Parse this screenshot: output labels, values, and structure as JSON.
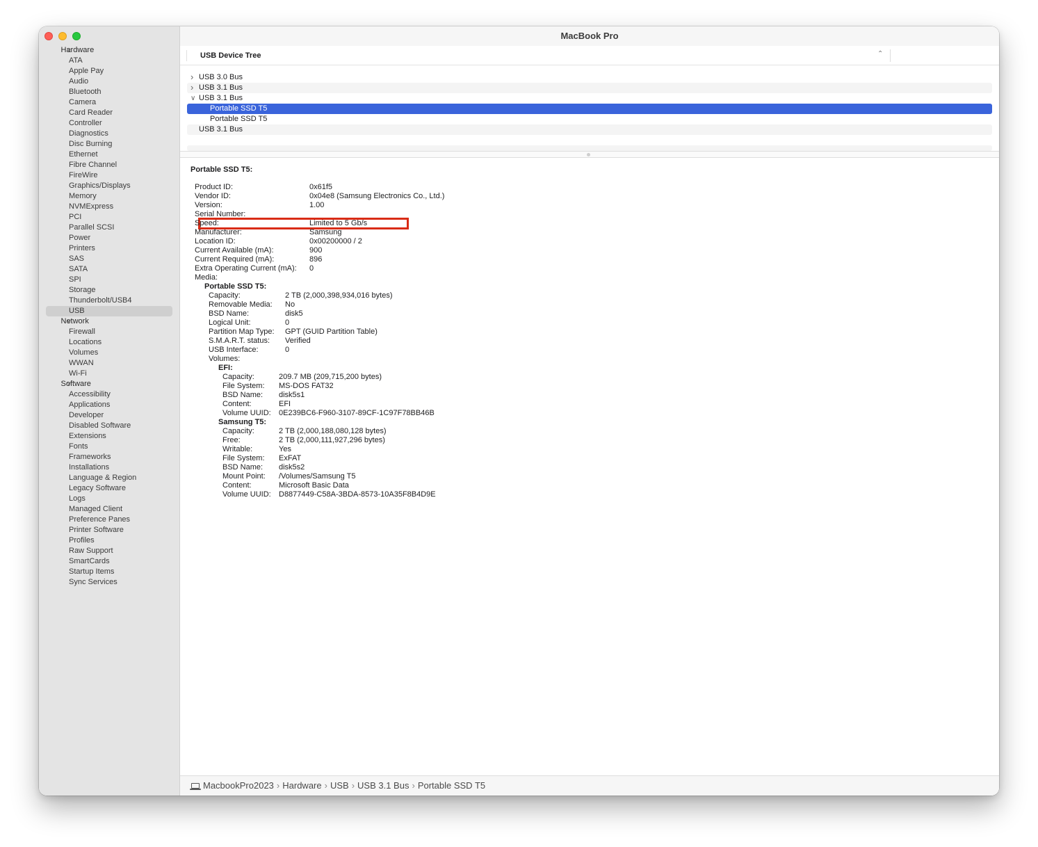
{
  "window": {
    "title": "MacBook Pro"
  },
  "sidebar": {
    "sections": [
      {
        "label": "Hardware",
        "items": [
          "ATA",
          "Apple Pay",
          "Audio",
          "Bluetooth",
          "Camera",
          "Card Reader",
          "Controller",
          "Diagnostics",
          "Disc Burning",
          "Ethernet",
          "Fibre Channel",
          "FireWire",
          "Graphics/Displays",
          "Memory",
          "NVMExpress",
          "PCI",
          "Parallel SCSI",
          "Power",
          "Printers",
          "SAS",
          "SATA",
          "SPI",
          "Storage",
          "Thunderbolt/USB4",
          "USB"
        ]
      },
      {
        "label": "Network",
        "items": [
          "Firewall",
          "Locations",
          "Volumes",
          "WWAN",
          "Wi-Fi"
        ]
      },
      {
        "label": "Software",
        "items": [
          "Accessibility",
          "Applications",
          "Developer",
          "Disabled Software",
          "Extensions",
          "Fonts",
          "Frameworks",
          "Installations",
          "Language & Region",
          "Legacy Software",
          "Logs",
          "Managed Client",
          "Preference Panes",
          "Printer Software",
          "Profiles",
          "Raw Support",
          "SmartCards",
          "Startup Items",
          "Sync Services"
        ]
      }
    ],
    "selected": "USB"
  },
  "device_tree": {
    "header": "USB Device Tree",
    "rows": [
      {
        "label": "USB 3.0 Bus",
        "level": 0,
        "expanded": false
      },
      {
        "label": "USB 3.1 Bus",
        "level": 0,
        "expanded": false
      },
      {
        "label": "USB 3.1 Bus",
        "level": 0,
        "expanded": true
      },
      {
        "label": "Portable SSD T5",
        "level": 1,
        "selected": true
      },
      {
        "label": "Portable SSD T5",
        "level": 1
      },
      {
        "label": "USB 3.1 Bus",
        "level": 0
      }
    ]
  },
  "detail": {
    "title": "Portable SSD T5:",
    "fields": [
      {
        "k": "Product ID:",
        "v": "0x61f5"
      },
      {
        "k": "Vendor ID:",
        "v": "0x04e8  (Samsung Electronics Co., Ltd.)"
      },
      {
        "k": "Version:",
        "v": "1.00"
      },
      {
        "k": "Serial Number:",
        "v": ""
      },
      {
        "k": "Speed:",
        "v": "Limited to 5 Gb/s"
      },
      {
        "k": "Manufacturer:",
        "v": "Samsung"
      },
      {
        "k": "Location ID:",
        "v": "0x00200000 / 2"
      },
      {
        "k": "Current Available (mA):",
        "v": "900"
      },
      {
        "k": "Current Required (mA):",
        "v": "896"
      },
      {
        "k": "Extra Operating Current (mA):",
        "v": "0"
      },
      {
        "k": "Media:",
        "v": ""
      }
    ],
    "media": {
      "title": "Portable SSD T5:",
      "fields": [
        {
          "k": "Capacity:",
          "v": "2 TB (2,000,398,934,016 bytes)"
        },
        {
          "k": "Removable Media:",
          "v": "No"
        },
        {
          "k": "BSD Name:",
          "v": "disk5"
        },
        {
          "k": "Logical Unit:",
          "v": "0"
        },
        {
          "k": "Partition Map Type:",
          "v": "GPT (GUID Partition Table)"
        },
        {
          "k": "S.M.A.R.T. status:",
          "v": "Verified"
        },
        {
          "k": "USB Interface:",
          "v": "0"
        },
        {
          "k": "Volumes:",
          "v": ""
        }
      ],
      "volumes": [
        {
          "title": "EFI:",
          "fields": [
            {
              "k": "Capacity:",
              "v": "209.7 MB (209,715,200 bytes)"
            },
            {
              "k": "File System:",
              "v": "MS-DOS FAT32"
            },
            {
              "k": "BSD Name:",
              "v": "disk5s1"
            },
            {
              "k": "Content:",
              "v": "EFI"
            },
            {
              "k": "Volume UUID:",
              "v": "0E239BC6-F960-3107-89CF-1C97F78BB46B"
            }
          ]
        },
        {
          "title": "Samsung T5:",
          "fields": [
            {
              "k": "Capacity:",
              "v": "2 TB (2,000,188,080,128 bytes)"
            },
            {
              "k": "Free:",
              "v": "2 TB (2,000,111,927,296 bytes)"
            },
            {
              "k": "Writable:",
              "v": "Yes"
            },
            {
              "k": "File System:",
              "v": "ExFAT"
            },
            {
              "k": "BSD Name:",
              "v": "disk5s2"
            },
            {
              "k": "Mount Point:",
              "v": "/Volumes/Samsung T5"
            },
            {
              "k": "Content:",
              "v": "Microsoft Basic Data"
            },
            {
              "k": "Volume UUID:",
              "v": "D8877449-C58A-3BDA-8573-10A35F8B4D9E"
            }
          ]
        }
      ]
    }
  },
  "pathbar": {
    "icon": "laptop-icon",
    "crumbs": [
      "MacbookPro2023",
      "Hardware",
      "USB",
      "USB 3.1 Bus",
      "Portable SSD T5"
    ]
  },
  "colors": {
    "selection": "#3a64db",
    "highlight_box": "#d92c16"
  }
}
